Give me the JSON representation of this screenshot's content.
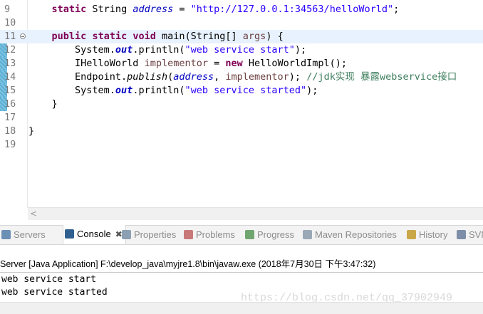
{
  "editor": {
    "lines": [
      {
        "n": "9",
        "tokens": [
          {
            "t": "    "
          },
          {
            "t": "static",
            "c": "kw"
          },
          {
            "t": " String "
          },
          {
            "t": "address",
            "c": "fld"
          },
          {
            "t": " = "
          },
          {
            "t": "\"http://127.0.0.1:34563/helloWorld\"",
            "c": "str"
          },
          {
            "t": ";"
          }
        ]
      },
      {
        "n": "10",
        "tokens": []
      },
      {
        "n": "11",
        "fold": true,
        "current": true,
        "tokens": [
          {
            "t": "    "
          },
          {
            "t": "public",
            "c": "kw"
          },
          {
            "t": " "
          },
          {
            "t": "static",
            "c": "kw"
          },
          {
            "t": " "
          },
          {
            "t": "void",
            "c": "kw"
          },
          {
            "t": " main(String[] "
          },
          {
            "t": "args",
            "c": "var"
          },
          {
            "t": ") {"
          }
        ]
      },
      {
        "n": "12",
        "tokens": [
          {
            "t": "        System."
          },
          {
            "t": "out",
            "c": "sfld"
          },
          {
            "t": ".println("
          },
          {
            "t": "\"web service start\"",
            "c": "str"
          },
          {
            "t": ");"
          }
        ]
      },
      {
        "n": "13",
        "tokens": [
          {
            "t": "        IHelloWorld "
          },
          {
            "t": "implementor",
            "c": "var"
          },
          {
            "t": " = "
          },
          {
            "t": "new",
            "c": "kw"
          },
          {
            "t": " HelloWorldImpl();"
          }
        ]
      },
      {
        "n": "14",
        "tokens": [
          {
            "t": "        Endpoint."
          },
          {
            "t": "publish",
            "c": "it"
          },
          {
            "t": "("
          },
          {
            "t": "address",
            "c": "fld"
          },
          {
            "t": ", "
          },
          {
            "t": "implementor",
            "c": "var"
          },
          {
            "t": "); "
          },
          {
            "t": "//jdk实现 暴露webservice接口",
            "c": "cmt"
          }
        ]
      },
      {
        "n": "15",
        "tokens": [
          {
            "t": "        System."
          },
          {
            "t": "out",
            "c": "sfld"
          },
          {
            "t": ".println("
          },
          {
            "t": "\"web service started\"",
            "c": "str"
          },
          {
            "t": ");"
          }
        ]
      },
      {
        "n": "16",
        "tokens": [
          {
            "t": "    }"
          }
        ]
      },
      {
        "n": "17",
        "tokens": []
      },
      {
        "n": "18",
        "tokens": [
          {
            "t": "}"
          }
        ]
      },
      {
        "n": "19",
        "tokens": []
      }
    ],
    "scroll_left_glyph": "<"
  },
  "tabs": [
    {
      "id": "servers",
      "label": "Servers",
      "icon": "servers-icon",
      "color": "#6b8fb5"
    },
    {
      "id": "console",
      "label": "Console",
      "icon": "console-icon",
      "color": "#2f5f8f",
      "active": true,
      "close": "✖"
    },
    {
      "id": "properties",
      "label": "Properties",
      "icon": "properties-icon",
      "color": "#8ca0b4"
    },
    {
      "id": "problems",
      "label": "Problems",
      "icon": "problems-icon",
      "color": "#c87878"
    },
    {
      "id": "progress",
      "label": "Progress",
      "icon": "progress-icon",
      "color": "#6fa56f"
    },
    {
      "id": "maven",
      "label": "Maven Repositories",
      "icon": "maven-repositories-icon",
      "color": "#9aa8b8"
    },
    {
      "id": "history",
      "label": "History",
      "icon": "history-icon",
      "color": "#c9a84a"
    },
    {
      "id": "svn",
      "label": "SVN",
      "icon": "svn-icon",
      "color": "#7d8fa8"
    }
  ],
  "console": {
    "header": "Server [Java Application] F:\\develop_java\\myjre1.8\\bin\\javaw.exe (2018年7月30日 下午3:47:32)",
    "output": [
      "web service start",
      "web service started"
    ]
  },
  "watermark": "https://blog.csdn.net/qq_37902949"
}
